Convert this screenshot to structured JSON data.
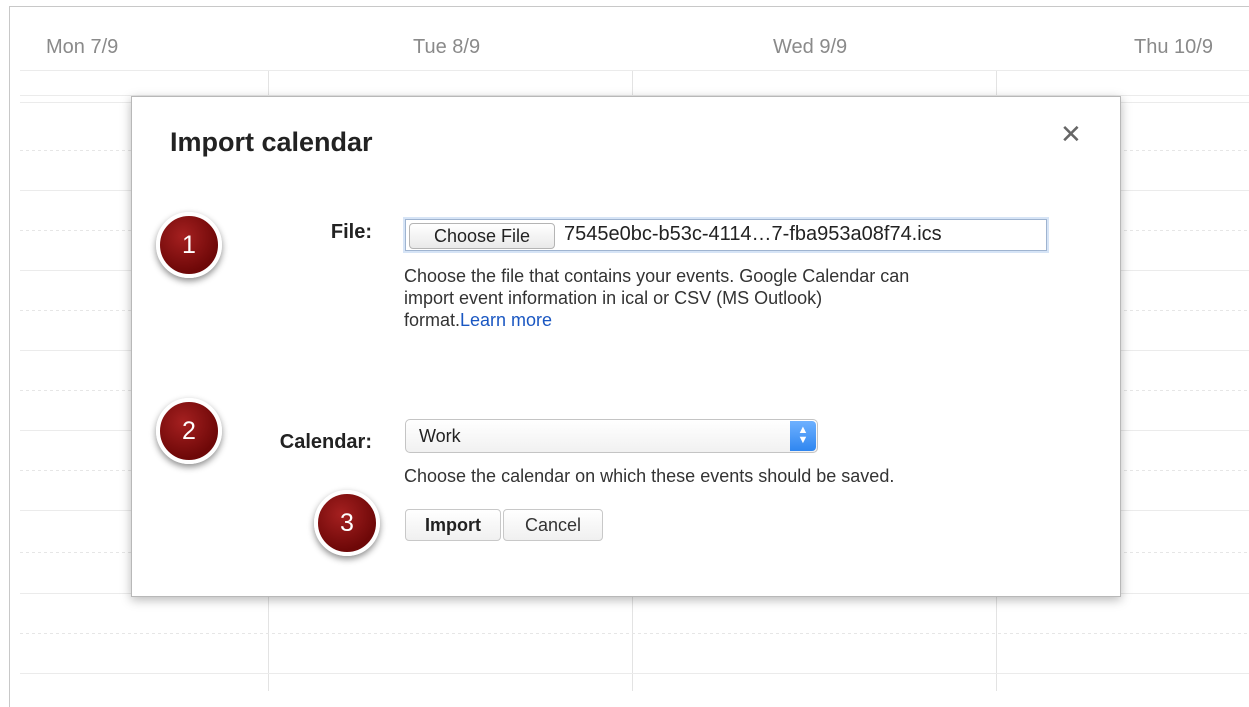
{
  "calendar_bg": {
    "days": [
      "Mon 7/9",
      "Tue 8/9",
      "Wed 9/9",
      "Thu 10/9"
    ]
  },
  "dialog": {
    "title": "Import calendar",
    "close_icon": "close-icon",
    "file": {
      "label": "File:",
      "button": "Choose File",
      "filename": "7545e0bc-b53c-4114…7-fba953a08f74.ics",
      "help_line1": "Choose the file that contains your events. Google Calendar can",
      "help_line2": "import event information in ical or CSV (MS Outlook)",
      "help_line3": "format.",
      "learn_more": "Learn more"
    },
    "calendar": {
      "label": "Calendar:",
      "selected": "Work",
      "help": "Choose the calendar on which these events should be saved."
    },
    "buttons": {
      "import": "Import",
      "cancel": "Cancel"
    }
  },
  "steps": [
    "1",
    "2",
    "3"
  ],
  "colors": {
    "badge": "#8b1111",
    "link": "#1a57c2",
    "select_accent": "#2f86f0"
  }
}
